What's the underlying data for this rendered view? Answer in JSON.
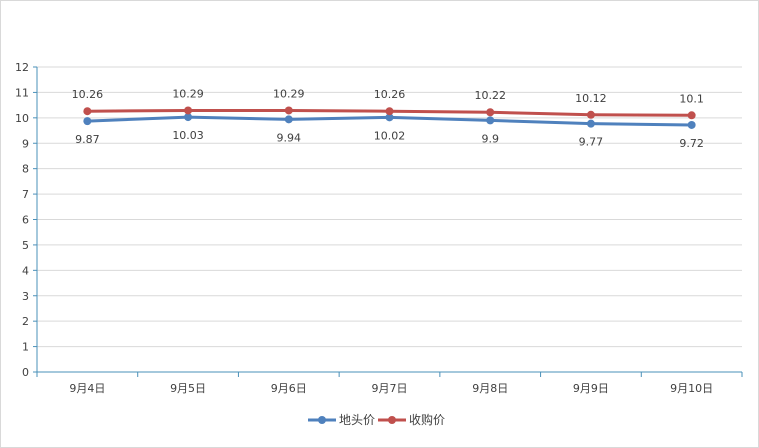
{
  "chart_data": {
    "type": "line",
    "categories": [
      "9月4日",
      "9月5日",
      "9月6日",
      "9月7日",
      "9月8日",
      "9月9日",
      "9月10日"
    ],
    "series": [
      {
        "name": "地头价",
        "color": "#4f81bd",
        "values": [
          9.87,
          10.03,
          9.94,
          10.02,
          9.9,
          9.77,
          9.72
        ],
        "labels": [
          "9.87",
          "10.03",
          "9.94",
          "10.02",
          "9.9",
          "9.77",
          "9.72"
        ],
        "label_position": "below"
      },
      {
        "name": "收购价",
        "color": "#c0504d",
        "values": [
          10.26,
          10.29,
          10.29,
          10.26,
          10.22,
          10.12,
          10.1
        ],
        "labels": [
          "10.26",
          "10.29",
          "10.29",
          "10.26",
          "10.22",
          "10.12",
          "10.1"
        ],
        "label_position": "above"
      }
    ],
    "ylim": [
      0,
      12
    ],
    "yticks": [
      "0",
      "1",
      "2",
      "3",
      "4",
      "5",
      "6",
      "7",
      "8",
      "9",
      "10",
      "11",
      "12"
    ],
    "grid": true,
    "legend": "bottom-center",
    "axis_color": "#4a90b8",
    "grid_color": "#d9d9d9"
  }
}
